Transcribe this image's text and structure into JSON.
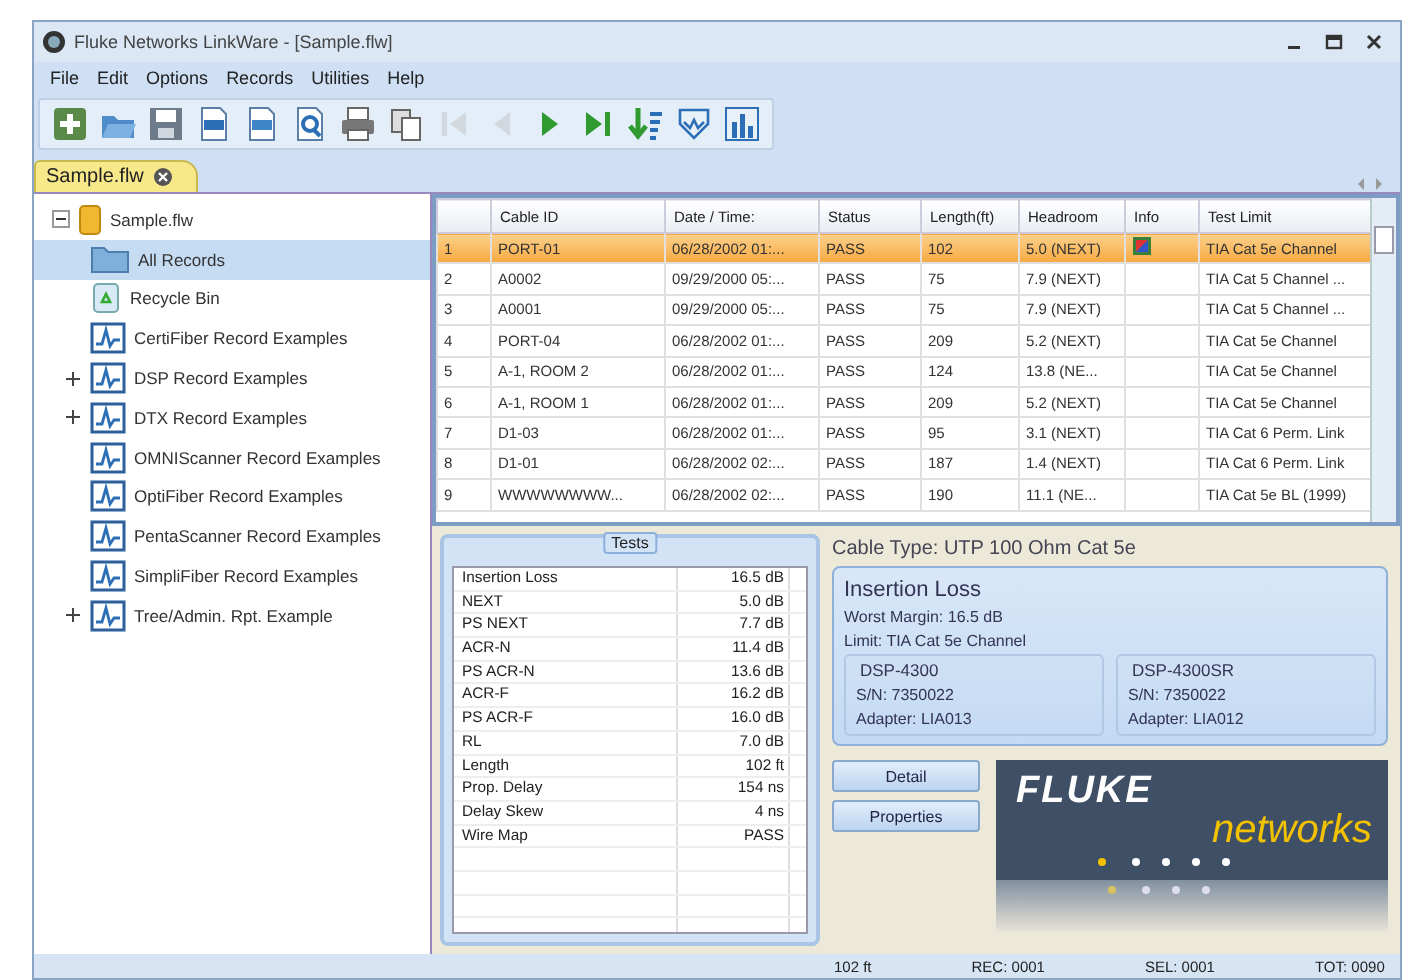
{
  "window": {
    "title": "Fluke Networks LinkWare - [Sample.flw]"
  },
  "menu": [
    "File",
    "Edit",
    "Options",
    "Records",
    "Utilities",
    "Help"
  ],
  "toolbar": [
    {
      "kind": "new",
      "disabled": false
    },
    {
      "kind": "open",
      "disabled": false
    },
    {
      "kind": "save",
      "disabled": false
    },
    {
      "kind": "pdf",
      "disabled": false
    },
    {
      "kind": "xml",
      "disabled": false
    },
    {
      "kind": "find",
      "disabled": false
    },
    {
      "kind": "print",
      "disabled": false
    },
    {
      "kind": "copy",
      "disabled": false
    },
    {
      "kind": "first",
      "disabled": true
    },
    {
      "kind": "prev",
      "disabled": true
    },
    {
      "kind": "next",
      "disabled": false
    },
    {
      "kind": "last",
      "disabled": false
    },
    {
      "kind": "sort",
      "disabled": false
    },
    {
      "kind": "test",
      "disabled": false
    },
    {
      "kind": "chart",
      "disabled": false
    }
  ],
  "doc_tab": {
    "label": "Sample.flw",
    "selected": true
  },
  "tree": {
    "label": "Sample.flw",
    "expanded": true,
    "children": [
      {
        "label": "All Records",
        "kind": "folder",
        "selected": true,
        "expander": false
      },
      {
        "label": "Recycle Bin",
        "kind": "recycle",
        "selected": false,
        "expander": false
      },
      {
        "label": "CertiFiber Record Examples",
        "kind": "records",
        "selected": false,
        "expander": false
      },
      {
        "label": "DSP Record Examples",
        "kind": "records",
        "selected": false,
        "expander": true
      },
      {
        "label": "DTX Record Examples",
        "kind": "records",
        "selected": false,
        "expander": true
      },
      {
        "label": "OMNIScanner Record Examples",
        "kind": "records",
        "selected": false,
        "expander": false
      },
      {
        "label": "OptiFiber Record Examples",
        "kind": "records",
        "selected": false,
        "expander": false
      },
      {
        "label": "PentaScanner Record Examples",
        "kind": "records",
        "selected": false,
        "expander": false
      },
      {
        "label": "SimpliFiber Record Examples",
        "kind": "records",
        "selected": false,
        "expander": false
      },
      {
        "label": "Tree/Admin. Rpt. Example",
        "kind": "records",
        "selected": false,
        "expander": true
      }
    ]
  },
  "table": {
    "columns": [
      "Cable ID",
      "Date / Time:",
      "Status",
      "Length(ft)",
      "Headroom",
      "Info",
      "Test Limit"
    ],
    "rows": [
      {
        "num": "1",
        "cells": [
          "PORT-01",
          "06/28/2002 01:...",
          "PASS",
          "102",
          "5.0 (NEXT)",
          "",
          "TIA Cat 5e Channel"
        ],
        "info": true,
        "selected": true
      },
      {
        "num": "2",
        "cells": [
          "A0002",
          "09/29/2000 05:...",
          "PASS",
          "75",
          "7.9 (NEXT)",
          "",
          "TIA Cat 5 Channel ..."
        ],
        "info": false,
        "selected": false
      },
      {
        "num": "3",
        "cells": [
          "A0001",
          "09/29/2000 05:...",
          "PASS",
          "75",
          "7.9 (NEXT)",
          "",
          "TIA Cat 5 Channel ..."
        ],
        "info": false,
        "selected": false
      },
      {
        "num": "4",
        "cells": [
          "PORT-04",
          "06/28/2002 01:...",
          "PASS",
          "209",
          "5.2 (NEXT)",
          "",
          "TIA Cat 5e Channel"
        ],
        "info": false,
        "selected": false
      },
      {
        "num": "5",
        "cells": [
          "A-1, ROOM 2",
          "06/28/2002 01:...",
          "PASS",
          "124",
          "13.8 (NE...",
          "",
          "TIA Cat 5e Channel"
        ],
        "info": false,
        "selected": false
      },
      {
        "num": "6",
        "cells": [
          "A-1, ROOM 1",
          "06/28/2002 01:...",
          "PASS",
          "209",
          "5.2 (NEXT)",
          "",
          "TIA Cat 5e Channel"
        ],
        "info": false,
        "selected": false
      },
      {
        "num": "7",
        "cells": [
          "D1-03",
          "06/28/2002 01:...",
          "PASS",
          "95",
          "3.1 (NEXT)",
          "",
          "TIA Cat 6  Perm. Link"
        ],
        "info": false,
        "selected": false
      },
      {
        "num": "8",
        "cells": [
          "D1-01",
          "06/28/2002 02:...",
          "PASS",
          "187",
          "1.4 (NEXT)",
          "",
          "TIA Cat 6  Perm. Link"
        ],
        "info": false,
        "selected": false
      },
      {
        "num": "9",
        "cells": [
          "WWWWWWWW...",
          "06/28/2002 02:...",
          "PASS",
          "190",
          "11.1 (NE...",
          "",
          "TIA Cat 5e BL (1999)"
        ],
        "info": false,
        "selected": false
      }
    ]
  },
  "tests": {
    "title": "Tests",
    "rows": [
      {
        "name": "Insertion Loss",
        "value": "16.5 dB"
      },
      {
        "name": "NEXT",
        "value": "5.0 dB"
      },
      {
        "name": "PS NEXT",
        "value": "7.7 dB"
      },
      {
        "name": "ACR-N",
        "value": "11.4 dB"
      },
      {
        "name": "PS ACR-N",
        "value": "13.6 dB"
      },
      {
        "name": "ACR-F",
        "value": "16.2 dB"
      },
      {
        "name": "PS ACR-F",
        "value": "16.0 dB"
      },
      {
        "name": "RL",
        "value": "7.0 dB"
      },
      {
        "name": "Length",
        "value": "102 ft"
      },
      {
        "name": "Prop. Delay",
        "value": "154 ns"
      },
      {
        "name": "Delay Skew",
        "value": "4 ns"
      },
      {
        "name": "Wire Map",
        "value": "PASS"
      }
    ]
  },
  "detail": {
    "cable_type": "Cable Type: UTP 100 Ohm Cat 5e",
    "heading": "Insertion Loss",
    "worst_margin": "Worst Margin: 16.5 dB",
    "limit": "Limit: TIA Cat 5e Channel",
    "units": [
      {
        "model": "DSP-4300",
        "serial": "S/N: 7350022",
        "adapter": "Adapter: LIA013"
      },
      {
        "model": "DSP-4300SR",
        "serial": "S/N: 7350022",
        "adapter": "Adapter: LIA012"
      }
    ],
    "buttons": [
      "Detail",
      "Properties"
    ],
    "logo": {
      "word1": "FLUKE",
      "word2": "networks"
    }
  },
  "status_bar": [
    "102 ft",
    "REC: 0001",
    "SEL: 0001",
    "TOT: 0090"
  ]
}
